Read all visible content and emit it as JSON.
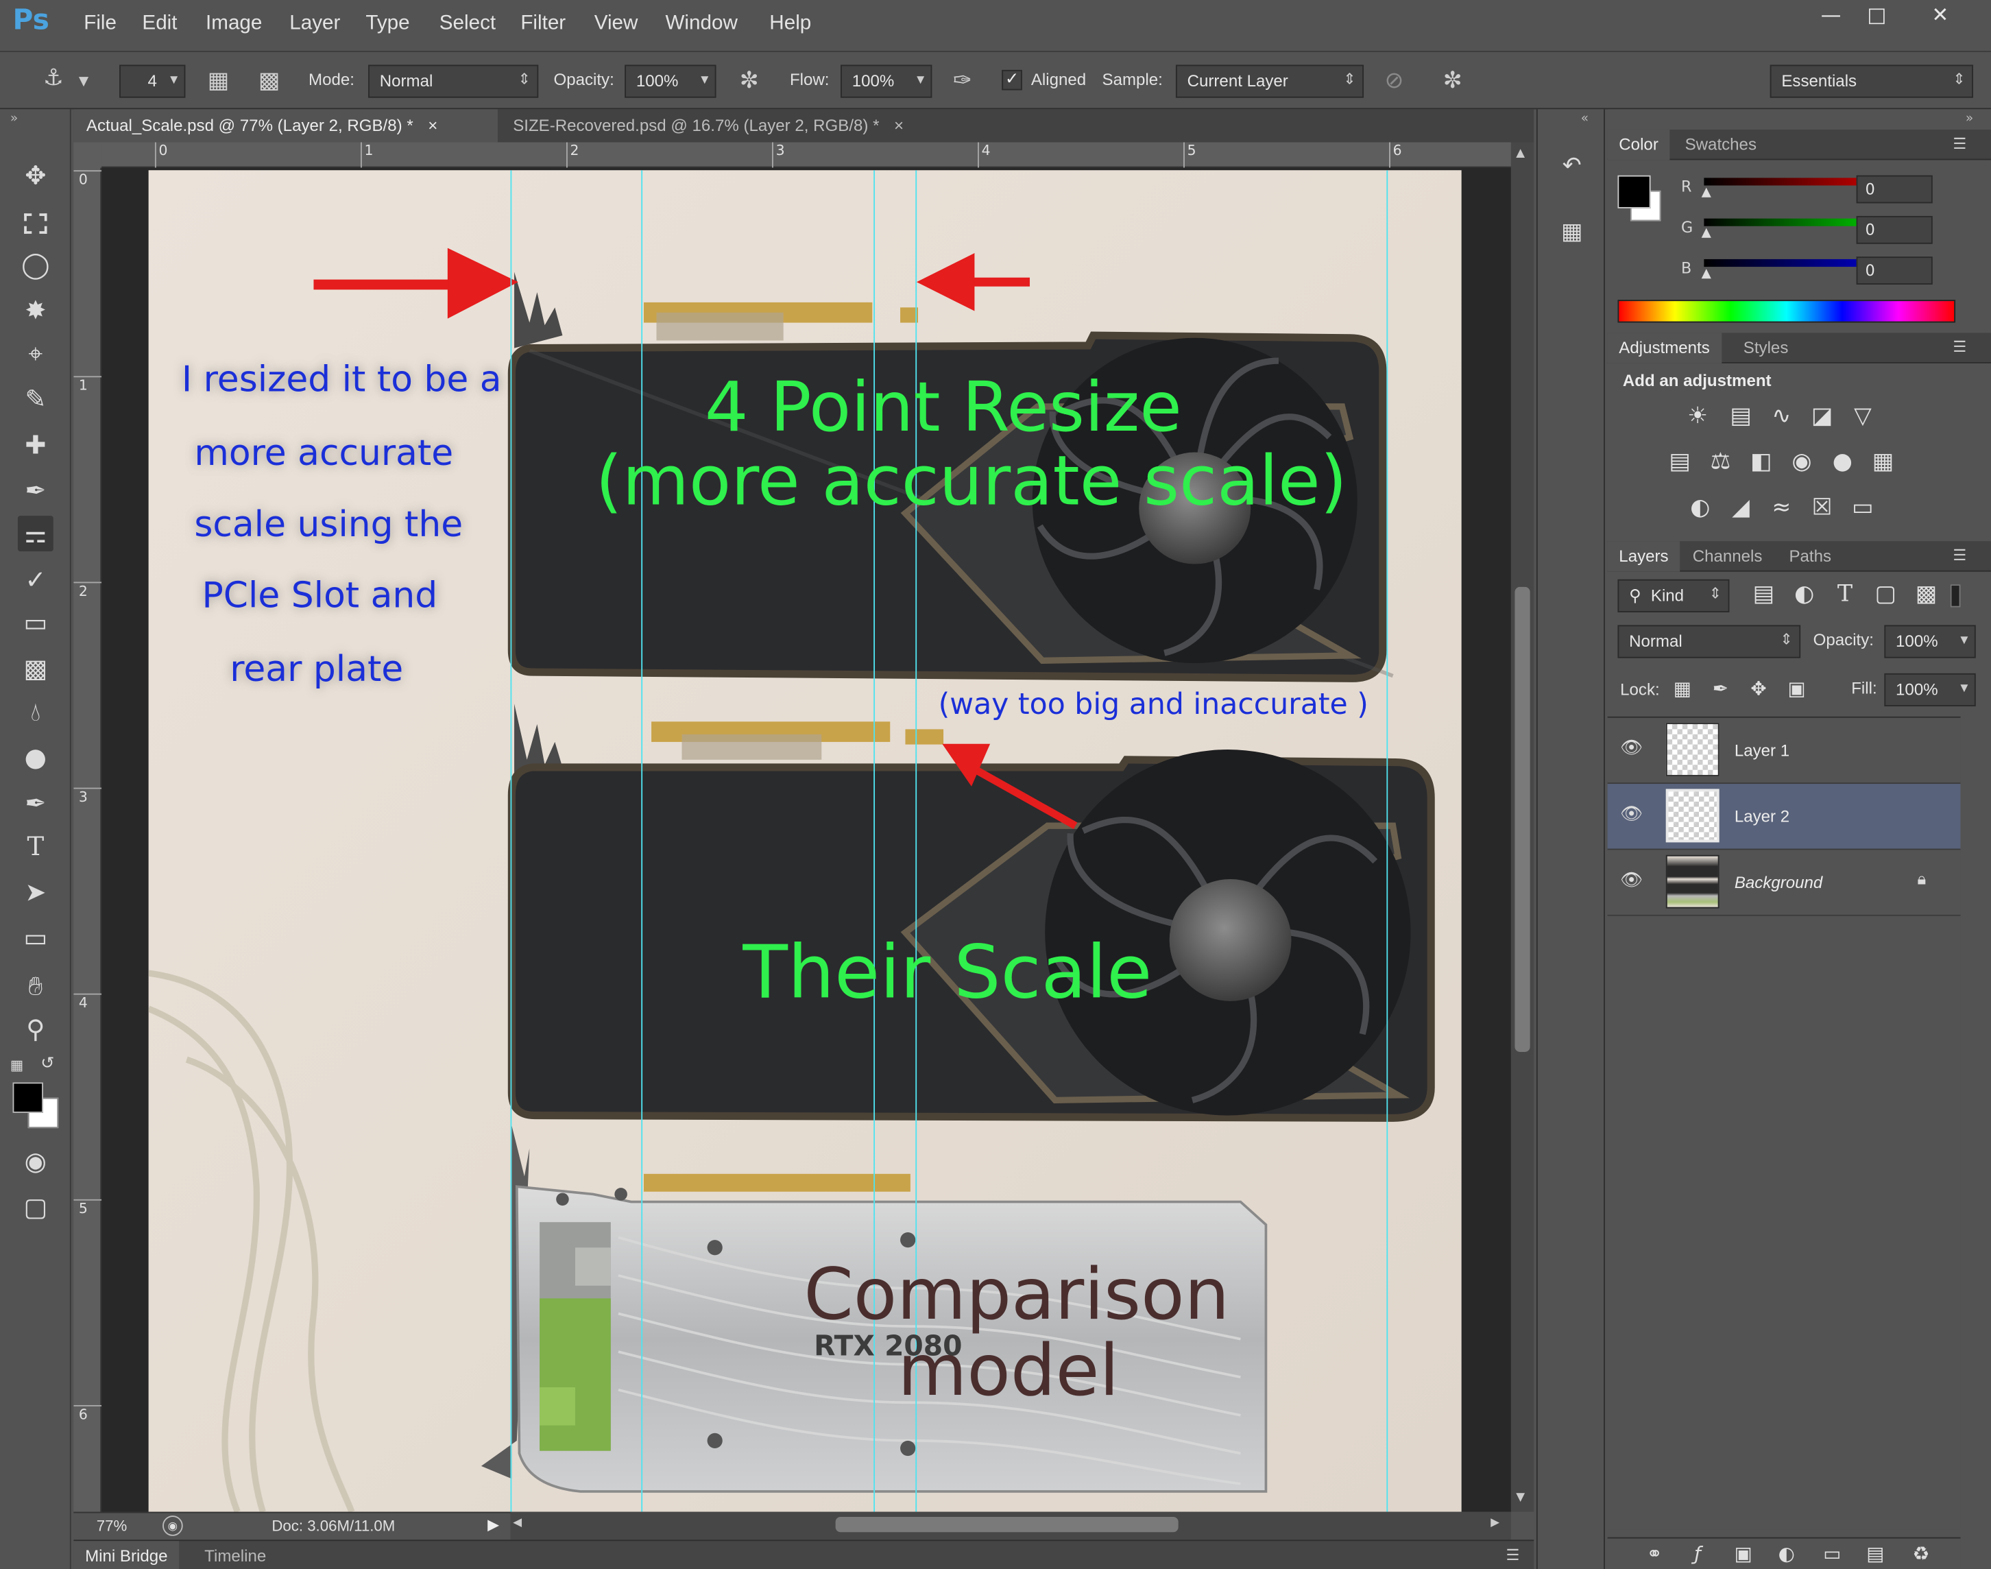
{
  "app": {
    "logo": "Ps"
  },
  "menu": [
    "File",
    "Edit",
    "Image",
    "Layer",
    "Type",
    "Select",
    "Filter",
    "View",
    "Window",
    "Help"
  ],
  "window_controls": {
    "minimize": "—",
    "maximize": "□",
    "close": "✕"
  },
  "options": {
    "brush_size": "4",
    "mode_label": "Mode:",
    "mode_value": "Normal",
    "opacity_label": "Opacity:",
    "opacity_value": "100%",
    "flow_label": "Flow:",
    "flow_value": "100%",
    "aligned_label": "Aligned",
    "aligned_checked": true,
    "sample_label": "Sample:",
    "sample_value": "Current Layer",
    "workspace": "Essentials"
  },
  "tabs": [
    {
      "label": "Actual_Scale.psd @ 77% (Layer 2, RGB/8) *",
      "close": "×",
      "active": true
    },
    {
      "label": "SIZE-Recovered.psd @ 16.7% (Layer 2, RGB/8) *",
      "close": "×",
      "active": false
    }
  ],
  "rulers": {
    "horizontal": [
      "0",
      "1",
      "2",
      "3",
      "4",
      "5",
      "6"
    ],
    "vertical": [
      "0",
      "1",
      "2",
      "3",
      "4",
      "5",
      "6"
    ]
  },
  "canvas": {
    "annotation_left": [
      "I resized it to be a",
      "more accurate",
      "scale using the",
      "PCle Slot and",
      "rear plate"
    ],
    "label_top_line1": "4 Point Resize",
    "label_top_line2": "(more accurate scale)",
    "label_middle_note": "(way too  big and inaccurate )",
    "label_middle": "Their Scale",
    "label_bottom_line1": "Comparison",
    "label_bottom_line2": "model",
    "card_print": "RTX 2080",
    "accent_red": "#e51d1d",
    "accent_green": "#2ff04c",
    "accent_blue": "#1a2fd8",
    "guide_color": "#4fe3f0"
  },
  "status": {
    "zoom": "77%",
    "doc": "Doc: 3.06M/11.0M"
  },
  "bottom_tabs": [
    "Mini Bridge",
    "Timeline"
  ],
  "color_panel": {
    "tabs": [
      "Color",
      "Swatches"
    ],
    "r_label": "R",
    "r_value": "0",
    "g_label": "G",
    "g_value": "0",
    "b_label": "B",
    "b_value": "0"
  },
  "adjustments_panel": {
    "tabs": [
      "Adjustments",
      "Styles"
    ],
    "heading": "Add an adjustment"
  },
  "layers_panel": {
    "tabs": [
      "Layers",
      "Channels",
      "Paths"
    ],
    "kind_label": "Kind",
    "blend_mode": "Normal",
    "opacity_label": "Opacity:",
    "opacity_value": "100%",
    "lock_label": "Lock:",
    "fill_label": "Fill:",
    "fill_value": "100%",
    "layers": [
      {
        "name": "Layer 1",
        "selected": false
      },
      {
        "name": "Layer 2",
        "selected": true
      },
      {
        "name": "Background",
        "selected": false,
        "locked": true
      }
    ]
  }
}
